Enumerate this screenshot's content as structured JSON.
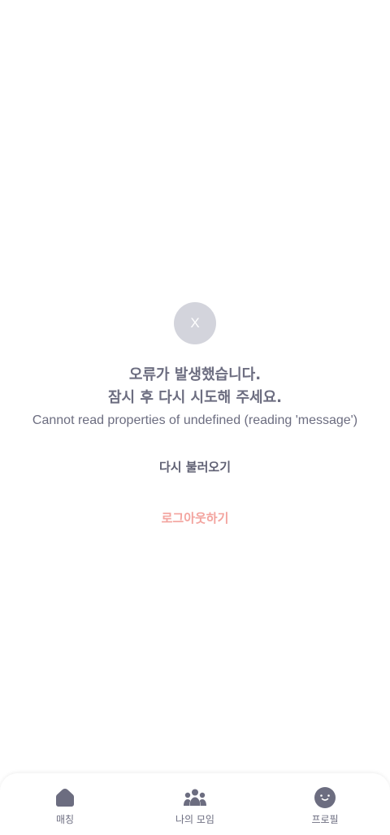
{
  "error": {
    "icon_text": "X",
    "title_line1": "오류가 발생했습니다.",
    "title_line2": "잠시 후 다시 시도해 주세요.",
    "message": "Cannot read properties of undefined (reading 'message')",
    "reload_label": "다시 불러오기",
    "logout_label": "로그아웃하기"
  },
  "nav": {
    "items": [
      {
        "label": "매칭",
        "icon": "home-icon"
      },
      {
        "label": "나의 모임",
        "icon": "group-icon"
      },
      {
        "label": "프로필",
        "icon": "smiley-face-icon"
      }
    ]
  },
  "colors": {
    "icon_circle": "#d3d4dc",
    "text": "#6c6d80",
    "logout": "#f3a39e",
    "nav_icon": "#6c6d80"
  }
}
